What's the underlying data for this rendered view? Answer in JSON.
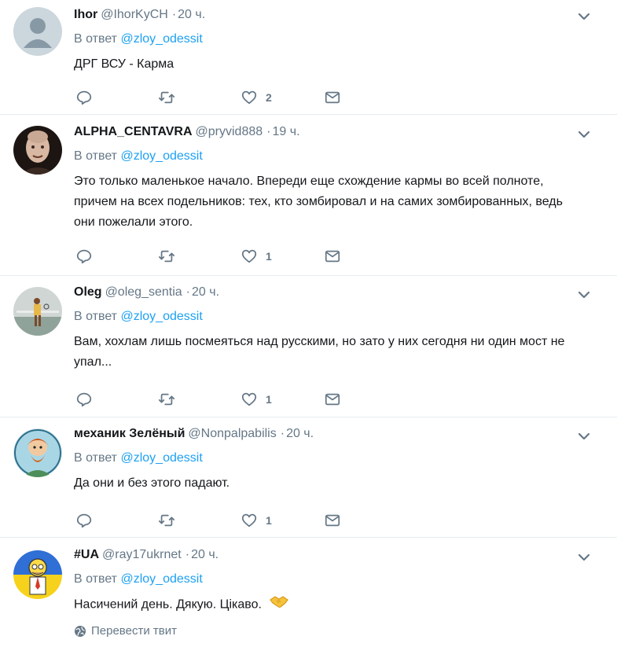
{
  "reply_prefix": "В ответ",
  "tweets": [
    {
      "fullname": "Ihor",
      "username": "@IhorKyCH",
      "time": "20 ч.",
      "reply_to": "@zloy_odessit",
      "text": "ДРГ ВСУ - Карма",
      "likes": "2",
      "avatar": "default-avatar"
    },
    {
      "fullname": "ALPHA_CENTAVRA",
      "username": "@pryvid888",
      "time": "19 ч.",
      "reply_to": "@zloy_odessit",
      "text": "Это только маленькое начало. Впереди еще схождение кармы во всей полноте, причем на всех подельников: тех, кто зомбировал и на самих зомбированных, ведь они пожелали этого.",
      "likes": "1",
      "avatar": "alien-face-avatar"
    },
    {
      "fullname": "Oleg",
      "username": "@oleg_sentia",
      "time": "20 ч.",
      "reply_to": "@zloy_odessit",
      "text": "Вам, хохлам лишь посмеяться над русскими, но зато у них сегодня ни один мост не упал...",
      "likes": "1",
      "avatar": "tennis-player-avatar"
    },
    {
      "fullname": "механик Зелёный",
      "username": "@Nonpalpabilis",
      "time": "20 ч.",
      "reply_to": "@zloy_odessit",
      "text": "Да они и без этого падают.",
      "likes": "1",
      "avatar": "cartoon-dwarf-avatar"
    },
    {
      "fullname": "#UA",
      "username": "@ray17ukrnet",
      "time": "20 ч.",
      "reply_to": "@zloy_odessit",
      "text": "Насичений день. Дякую. Цікаво.",
      "likes": "",
      "avatar": "cartoon-ukraine-avatar",
      "translate": "Перевести твит"
    }
  ],
  "colors": {
    "link": "#1da1f2",
    "secondary": "#657786",
    "border": "#e6ecf0"
  }
}
